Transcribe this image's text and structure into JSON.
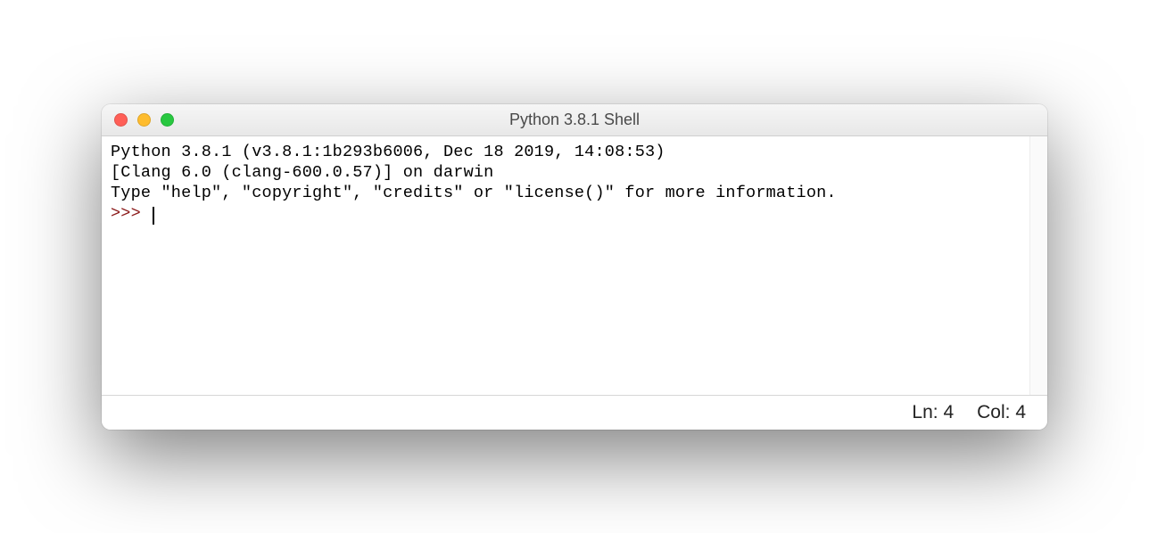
{
  "window": {
    "title": "Python 3.8.1 Shell"
  },
  "shell": {
    "line1": "Python 3.8.1 (v3.8.1:1b293b6006, Dec 18 2019, 14:08:53) ",
    "line2": "[Clang 6.0 (clang-600.0.57)] on darwin",
    "line3": "Type \"help\", \"copyright\", \"credits\" or \"license()\" for more information.",
    "prompt": ">>> "
  },
  "status": {
    "line": "Ln: 4",
    "col": "Col: 4"
  }
}
